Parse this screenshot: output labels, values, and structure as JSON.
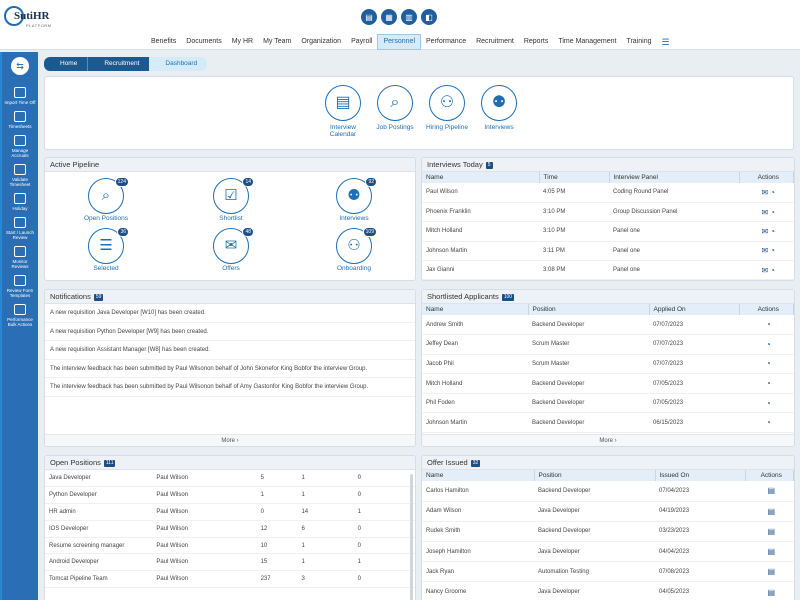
{
  "brand": {
    "name": "SutiHR",
    "sub": "PLATFORM"
  },
  "top_icons": [
    "doc-icon",
    "calendar-icon",
    "report-icon",
    "chart-icon"
  ],
  "menu": [
    "Benefits",
    "Documents",
    "My HR",
    "My Team",
    "Organization",
    "Payroll",
    "Personnel",
    "Performance",
    "Recruitment",
    "Reports",
    "Time Management",
    "Training"
  ],
  "menu_active": "Personnel",
  "sidebar": [
    {
      "label": "Import Time Off",
      "icon": "import-icon"
    },
    {
      "label": "Timesheets",
      "icon": "timesheet-icon"
    },
    {
      "label": "Manage Accruals",
      "icon": "accruals-icon"
    },
    {
      "label": "Validate Timesheet",
      "icon": "validate-icon"
    },
    {
      "label": "Holiday",
      "icon": "holiday-icon"
    },
    {
      "label": "Start / Launch Review",
      "icon": "launch-icon"
    },
    {
      "label": "Monitor Reviews",
      "icon": "monitor-icon"
    },
    {
      "label": "Review Form Templates",
      "icon": "template-icon"
    },
    {
      "label": "Performance Bulk Actions",
      "icon": "bulk-icon"
    }
  ],
  "breadcrumb": {
    "home": "Home",
    "recruitment": "Recruitment",
    "dashboard": "Dashboard"
  },
  "quick_links": [
    "Interview Calendar",
    "Job Postings",
    "Hiring Pipeline",
    "Interviews"
  ],
  "active_pipeline": {
    "title": "Active Pipeline",
    "items": [
      {
        "label": "Open Positions",
        "count": "124"
      },
      {
        "label": "Shortlist",
        "count": "14"
      },
      {
        "label": "Interviews",
        "count": "92"
      },
      {
        "label": "Selected",
        "count": "36"
      },
      {
        "label": "Offers",
        "count": "48"
      },
      {
        "label": "Onboarding",
        "count": "109"
      }
    ]
  },
  "interviews_today": {
    "title": "Interviews Today",
    "count": "5",
    "columns": [
      "Name",
      "Time",
      "Interview Panel",
      "Actions"
    ],
    "rows": [
      [
        "Paul Wilson",
        "4:05 PM",
        "Coding Round Panel"
      ],
      [
        "Phoenix Franklin",
        "3:10 PM",
        "Group Discussion Panel"
      ],
      [
        "Mitch Holland",
        "3:10 PM",
        "Panel one"
      ],
      [
        "Johnson Martin",
        "3:11 PM",
        "Panel one"
      ],
      [
        "Jax Gianni",
        "3:08 PM",
        "Panel one"
      ]
    ]
  },
  "notifications": {
    "title": "Notifications",
    "count": "59",
    "items": [
      "A new requisition Java Developer [W10] has been created.",
      "A new requisition Python Developer [W9] has been created.",
      "A new requisition Assistant Manager [W8] has been created.",
      "The interview feedback has been submitted by Paul Wilsonon behalf of John Skonefor King Bobfor the interview Group.",
      "The interview feedback has been submitted by Paul Wilsonon behalf of Amy Gastonfor King Bobfor the interview Group."
    ],
    "more": "More ›"
  },
  "shortlisted": {
    "title": "Shortlisted Applicants",
    "count": "100",
    "columns": [
      "Name",
      "Position",
      "Applied On",
      "Actions"
    ],
    "rows": [
      [
        "Andrew Smith",
        "Backend Developer",
        "07/07/2023"
      ],
      [
        "Jeffey Dean",
        "Scrum Master",
        "07/07/2023"
      ],
      [
        "Jacob Phil",
        "Scrum Master",
        "07/07/2023"
      ],
      [
        "Mitch Holland",
        "Backend Developer",
        "07/05/2023"
      ],
      [
        "Phil Foden",
        "Backend Developer",
        "07/05/2023"
      ],
      [
        "Johnson Martin",
        "Backend Developer",
        "06/15/2023"
      ]
    ],
    "more": "More ›"
  },
  "open_positions": {
    "title": "Open Positions",
    "count": "111",
    "rows": [
      [
        "Java Developer",
        "Paul Wilson",
        "5",
        "1",
        "0"
      ],
      [
        "Python Developer",
        "Paul Wilson",
        "1",
        "1",
        "0"
      ],
      [
        "HR admin",
        "Paul Wilson",
        "0",
        "14",
        "1"
      ],
      [
        "IOS Developer",
        "Paul Wilson",
        "12",
        "6",
        "0"
      ],
      [
        "Resume screening manager",
        "Paul Wilson",
        "10",
        "1",
        "0"
      ],
      [
        "Android Developer",
        "Paul Wilson",
        "15",
        "1",
        "1"
      ],
      [
        "Tomcat Pipeline Team",
        "Paul Wilson",
        "237",
        "3",
        "0"
      ]
    ]
  },
  "offer_issued": {
    "title": "Offer Issued",
    "count": "32",
    "columns": [
      "Name",
      "Position",
      "Issued On",
      "Actions"
    ],
    "rows": [
      [
        "Carlos Hamilton",
        "Backend Developer",
        "07/04/2023"
      ],
      [
        "Adam Wilson",
        "Java Developer",
        "04/19/2023"
      ],
      [
        "Rudek Smith",
        "Backend Developer",
        "03/23/2023"
      ],
      [
        "Joseph Hamilton",
        "Java Developer",
        "04/04/2023"
      ],
      [
        "Jack Ryan",
        "Automation Testing",
        "07/08/2023"
      ],
      [
        "Nancy Groome",
        "Java Developer",
        "04/05/2023"
      ]
    ]
  }
}
